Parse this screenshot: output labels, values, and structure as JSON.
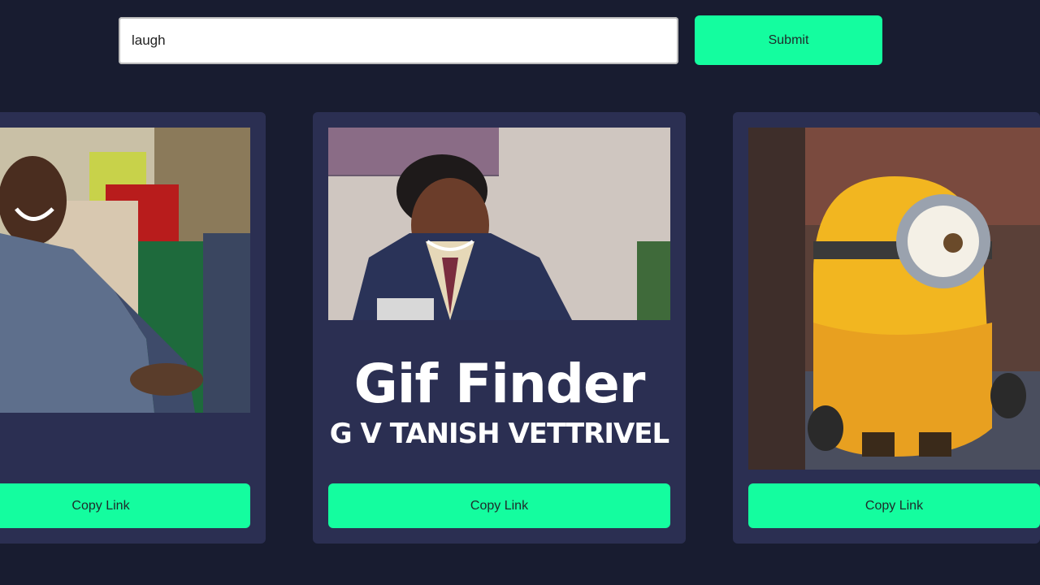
{
  "search": {
    "value": "laugh",
    "submit_label": "Submit"
  },
  "cards": [
    {
      "copy_label": "Copy Link"
    },
    {
      "copy_label": "Copy Link"
    },
    {
      "copy_label": "Copy Link"
    }
  ],
  "overlay": {
    "title": "Gif Finder",
    "subtitle": "G V TANISH VETTRIVEL"
  },
  "colors": {
    "background": "#181c30",
    "card": "#2b2f52",
    "accent": "#14fd9f"
  }
}
